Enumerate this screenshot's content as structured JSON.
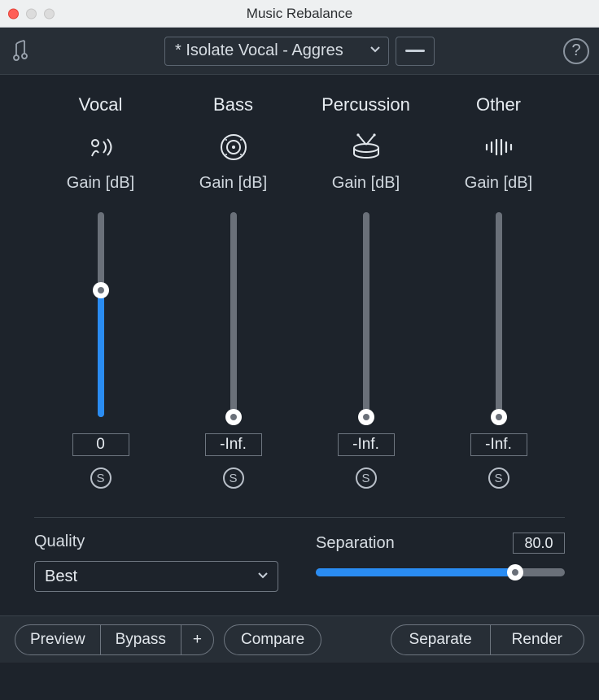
{
  "window": {
    "title": "Music Rebalance"
  },
  "toolbar": {
    "preset": "* Isolate Vocal - Aggres"
  },
  "channels": [
    {
      "name": "Vocal",
      "gain_label": "Gain [dB]",
      "value": "0",
      "fillPct": 62,
      "solo": "S"
    },
    {
      "name": "Bass",
      "gain_label": "Gain [dB]",
      "value": "-Inf.",
      "fillPct": 0,
      "solo": "S"
    },
    {
      "name": "Percussion",
      "gain_label": "Gain [dB]",
      "value": "-Inf.",
      "fillPct": 0,
      "solo": "S"
    },
    {
      "name": "Other",
      "gain_label": "Gain [dB]",
      "value": "-Inf.",
      "fillPct": 0,
      "solo": "S"
    }
  ],
  "quality": {
    "label": "Quality",
    "value": "Best"
  },
  "separation": {
    "label": "Separation",
    "value": "80.0",
    "pct": 80
  },
  "footer": {
    "preview": "Preview",
    "bypass": "Bypass",
    "plus": "+",
    "compare": "Compare",
    "separate": "Separate",
    "render": "Render"
  }
}
